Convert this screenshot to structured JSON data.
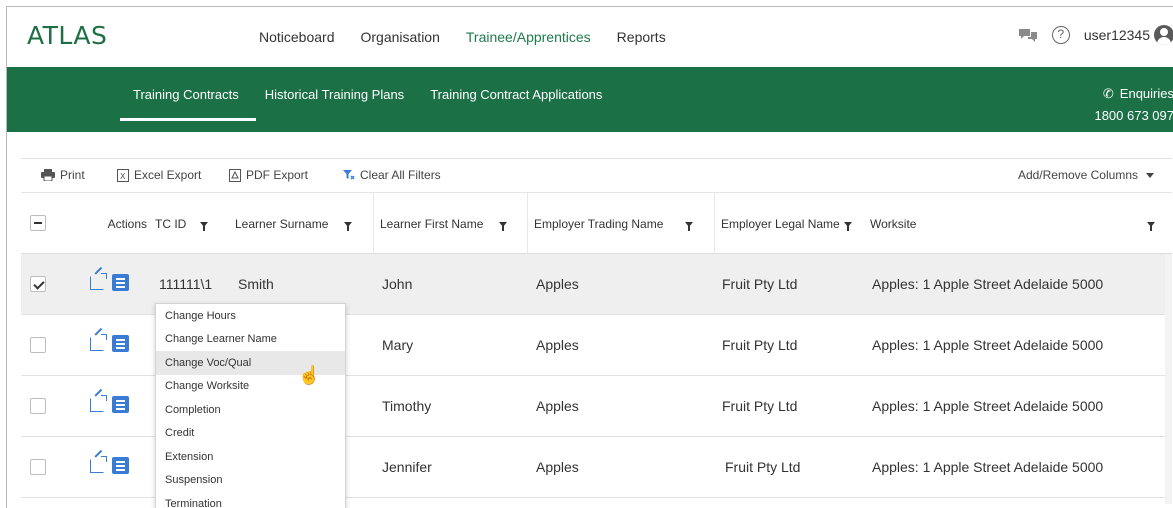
{
  "app": {
    "logo": "ATLAS"
  },
  "main_nav": [
    {
      "label": "Noticeboard",
      "active": false
    },
    {
      "label": "Organisation",
      "active": false
    },
    {
      "label": "Trainee/Apprentices",
      "active": true
    },
    {
      "label": "Reports",
      "active": false
    }
  ],
  "user": {
    "name": "user12345"
  },
  "sub_nav": [
    {
      "label": "Training Contracts",
      "active": true
    },
    {
      "label": "Historical Training Plans",
      "active": false
    },
    {
      "label": "Training Contract Applications",
      "active": false
    }
  ],
  "enquiries": {
    "label": "Enquiries",
    "phone": "1800 673 097"
  },
  "toolbar": {
    "print": "Print",
    "excel": "Excel Export",
    "pdf": "PDF Export",
    "clear": "Clear All Filters",
    "add_remove": "Add/Remove Columns"
  },
  "columns": [
    "Actions",
    "TC ID",
    "Learner Surname",
    "Learner First Name",
    "Employer Trading Name",
    "Employer Legal Name",
    "Worksite"
  ],
  "rows": [
    {
      "tc_id": "111111\\1",
      "surname": "Smith",
      "first_name": "John",
      "trading": "Apples",
      "legal": "Fruit Pty Ltd",
      "worksite": "Apples: 1 Apple Street Adelaide 5000",
      "selected": true
    },
    {
      "tc_id": "",
      "surname": "",
      "first_name": "Mary",
      "trading": "Apples",
      "legal": "Fruit Pty Ltd",
      "worksite": "Apples: 1 Apple Street Adelaide 5000",
      "selected": false
    },
    {
      "tc_id": "",
      "surname": "",
      "first_name": "Timothy",
      "trading": "Apples",
      "legal": "Fruit Pty Ltd",
      "worksite": "Apples: 1 Apple Street Adelaide 5000",
      "selected": false
    },
    {
      "tc_id": "",
      "surname": "",
      "first_name": "Jennifer",
      "trading": "Apples",
      "legal": "Fruit Pty Ltd",
      "worksite": "Apples: 1 Apple Street Adelaide 5000",
      "selected": false
    }
  ],
  "dropdown_menu": [
    "Change Hours",
    "Change Learner Name",
    "Change Voc/Qual",
    "Change Worksite",
    "Completion",
    "Credit",
    "Extension",
    "Suspension",
    "Termination"
  ],
  "dropdown_hover_index": 2,
  "colors": {
    "brand_green": "#1b7046",
    "accent_blue": "#3a7bd5"
  }
}
